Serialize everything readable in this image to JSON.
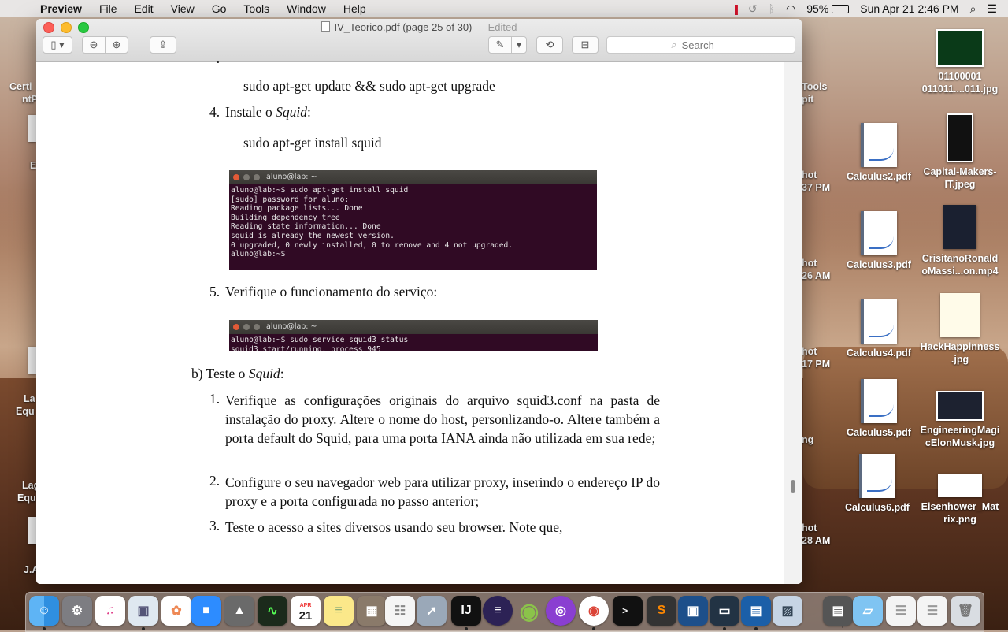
{
  "menubar": {
    "app_name": "Preview",
    "items": [
      "File",
      "Edit",
      "View",
      "Go",
      "Tools",
      "Window",
      "Help"
    ],
    "battery": "95%",
    "datetime": "Sun Apr 21  2:46 PM"
  },
  "window": {
    "title": "IV_Teorico.pdf (page 25 of 30)",
    "edited": "— Edited",
    "search_placeholder": "Search"
  },
  "document": {
    "top_cmd": "sudo apt-get update && sudo apt-get upgrade",
    "step4_num": "4.",
    "step4_text": "Instale o ",
    "step4_em": "Squid",
    "step4_tail": ":",
    "step4_cmd": "sudo apt-get install squid",
    "terminal1": {
      "title": "aluno@lab: ~",
      "lines": [
        "aluno@lab:~$ sudo apt-get install squid",
        "[sudo] password for aluno:",
        "Reading package lists... Done",
        "Building dependency tree",
        "Reading state information... Done",
        "squid is already the newest version.",
        "0 upgraded, 0 newly installed, 0 to remove and 4 not upgraded.",
        "aluno@lab:~$"
      ]
    },
    "step5_num": "5.",
    "step5_text": "Verifique o funcionamento do serviço:",
    "terminal2": {
      "title": "aluno@lab: ~",
      "lines": [
        "aluno@lab:~$ sudo service squid3 status",
        "squid3 start/running, process 945"
      ]
    },
    "section_b": "b) Teste o ",
    "section_b_em": "Squid",
    "section_b_tail": ":",
    "b1_num": "1.",
    "b1_text": "Verifique as configurações originais do arquivo squid3.conf na pasta de instalação do proxy. Altere o nome do host, personlizando-o. Altere também a porta default do Squid, para uma porta IANA ainda não utilizada em sua rede;",
    "b2_num": "2.",
    "b2_text": "Configure o seu navegador web para utilizar proxy, inserindo o endereço IP do proxy e a porta configurada no passo anterior;",
    "b3_num": "3.",
    "b3_text": "Teste o acesso a sites diversos usando seu browser. Note que,"
  },
  "desktop": {
    "right_col1": [
      "Calculus2.pdf",
      "Calculus3.pdf",
      "Calculus4.pdf",
      "Calculus5.pdf",
      "Calculus6.pdf"
    ],
    "right_col2": [
      "01100001 011011....011.jpg",
      "Capital-Makers-IT.jpeg",
      "CrisitanoRonald oMassi...on.mp4",
      "HackHappinness .jpg",
      "EngineeringMagi cElonMusk.jpg",
      "Eisenhower_Mat rix.png"
    ],
    "partial_right": [
      "Tools",
      "pit",
      "hot",
      "37 PM",
      "hot",
      "26 AM",
      "hot",
      "17 PM",
      "ng",
      "hot",
      "28 AM"
    ],
    "partial_left": [
      "Certi",
      "ntP",
      "E",
      "La",
      "Equ",
      "Lag",
      "Equ",
      "J.A"
    ]
  },
  "dock": {
    "apps": [
      "finder",
      "system-preferences",
      "itunes",
      "preview",
      "photos",
      "zoom",
      "app-xcode",
      "activity-monitor",
      "calendar",
      "notes",
      "calculator",
      "reminders",
      "launchpad",
      "intellij",
      "eclipse",
      "android-studio",
      "podcast",
      "chrome",
      "terminal",
      "sublime-text",
      "virtualbox",
      "screens",
      "parallels",
      "preview-2",
      "scanner",
      "folder",
      "documents-1",
      "documents-2",
      "trash"
    ],
    "calendar_month": "APR",
    "calendar_day": "21"
  },
  "colors": {
    "terminal_bg": "#300a24",
    "menubar_bg": "#ececec"
  }
}
